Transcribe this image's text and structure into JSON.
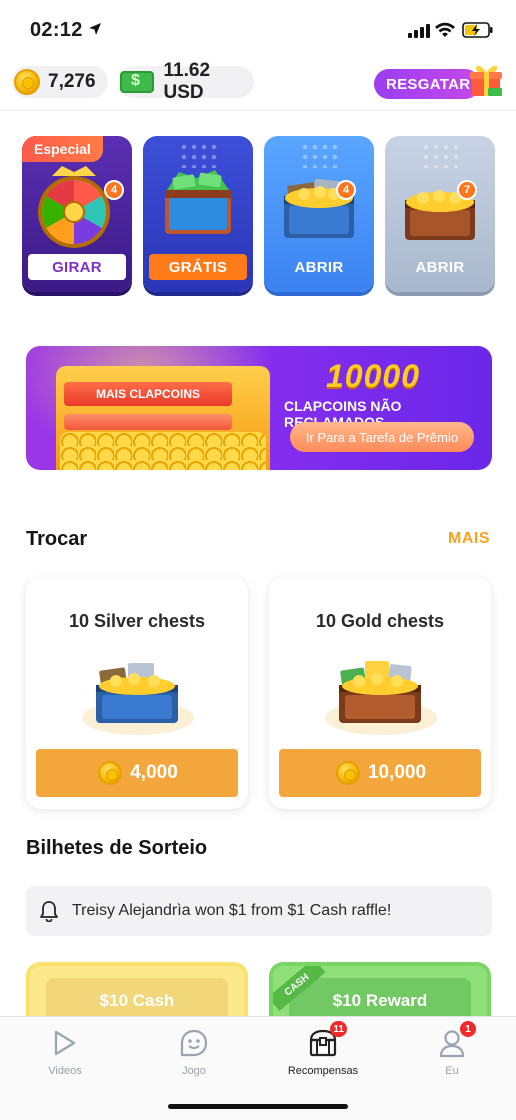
{
  "status_bar": {
    "time": "02:12"
  },
  "balance": {
    "coins": "7,276",
    "cash": "11.62 USD",
    "redeem_label": "RESGATAR"
  },
  "tasks": [
    {
      "tag": "Especial",
      "badge": "4",
      "label": "GIRAR"
    },
    {
      "badge": "",
      "label": "GRÁTIS"
    },
    {
      "badge": "4",
      "label": "ABRIR"
    },
    {
      "badge": "7",
      "label": "ABRIR"
    }
  ],
  "banner": {
    "bar_label": "MAIS CLAPCOINS",
    "amount": "10000",
    "subtitle": "CLAPCOINS NÃO RECLAMADOS",
    "cta": "Ir Para a Tarefa de Prêmio"
  },
  "trade": {
    "title": "Trocar",
    "more": "MAIS",
    "items": [
      {
        "name": "10 Silver chests",
        "price": "4,000"
      },
      {
        "name": "10 Gold chests",
        "price": "10,000"
      }
    ]
  },
  "raffle": {
    "title": "Bilhetes de Sorteio",
    "notice": "Treisy Alejandrìa won $1 from $1 Cash raffle!",
    "cards": [
      {
        "label": "$10 Cash"
      },
      {
        "label": "$10 Reward",
        "ribbon": "CASH"
      }
    ]
  },
  "tabbar": {
    "items": [
      {
        "label": "Videos",
        "badge": ""
      },
      {
        "label": "Jogo",
        "badge": ""
      },
      {
        "label": "Recompensas",
        "badge": "11"
      },
      {
        "label": "Eu",
        "badge": "1"
      }
    ]
  },
  "colors": {
    "accent_orange": "#f3a63b",
    "redeem_purple": "#9b3ef0",
    "banner_purple": "#8b2ff0"
  },
  "icons": [
    "location-arrow-icon",
    "signal-icon",
    "wifi-icon",
    "battery-charging-icon",
    "coin-icon",
    "cash-bill-icon",
    "gift-icon",
    "prize-wheel-icon",
    "cash-chest-icon",
    "silver-chest-icon",
    "gold-chest-icon",
    "bell-icon",
    "play-icon",
    "game-icon",
    "treasure-chest-icon",
    "user-icon"
  ]
}
